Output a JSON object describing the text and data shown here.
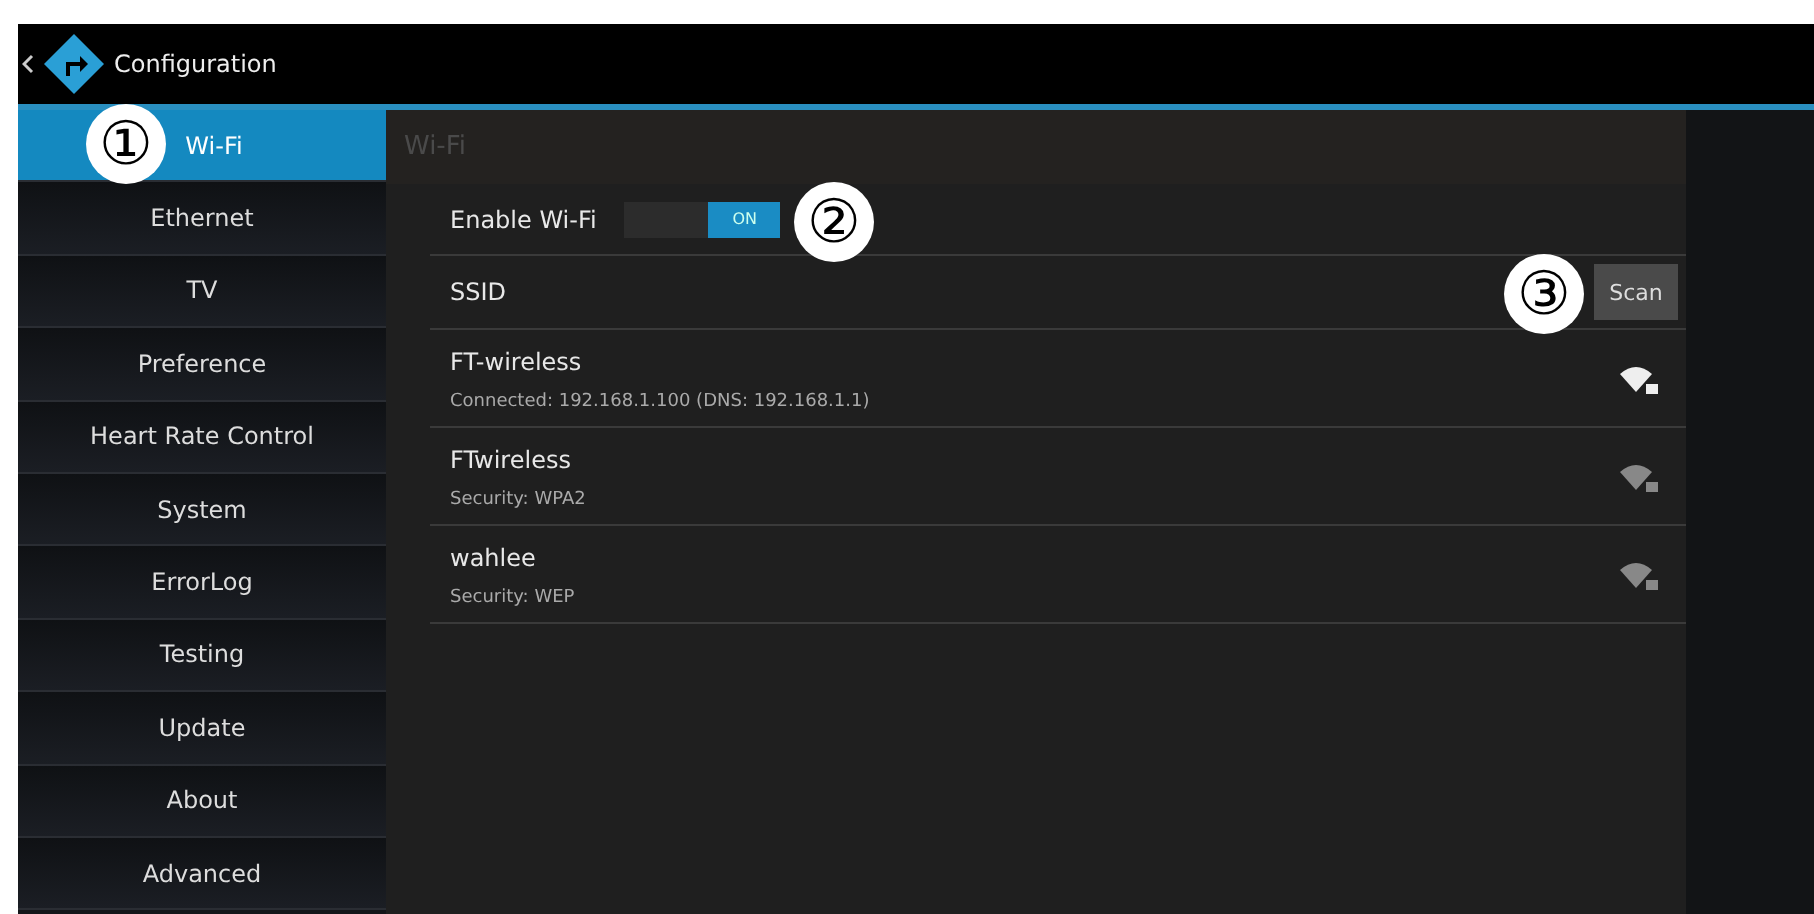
{
  "header": {
    "title": "Configuration"
  },
  "sidebar": {
    "items": [
      {
        "label": "Wi-Fi",
        "selected": true
      },
      {
        "label": "Ethernet",
        "selected": false
      },
      {
        "label": "TV",
        "selected": false
      },
      {
        "label": "Preference",
        "selected": false
      },
      {
        "label": "Heart Rate Control",
        "selected": false
      },
      {
        "label": "System",
        "selected": false
      },
      {
        "label": "ErrorLog",
        "selected": false
      },
      {
        "label": "Testing",
        "selected": false
      },
      {
        "label": "Update",
        "selected": false
      },
      {
        "label": "About",
        "selected": false
      },
      {
        "label": "Advanced",
        "selected": false
      }
    ]
  },
  "panel": {
    "title": "Wi-Fi",
    "enable": {
      "label": "Enable Wi-Fi",
      "toggle": "ON",
      "on": true
    },
    "ssid_label": "SSID",
    "scan_button": "Scan",
    "networks": [
      {
        "name": "FT-wireless",
        "detail": "Connected: 192.168.1.100 (DNS: 192.168.1.1)",
        "connected": true
      },
      {
        "name": "FTwireless",
        "detail": "Security: WPA2",
        "connected": false
      },
      {
        "name": "wahlee",
        "detail": "Security: WEP",
        "connected": false
      }
    ]
  },
  "callouts": [
    "①",
    "②",
    "③"
  ]
}
